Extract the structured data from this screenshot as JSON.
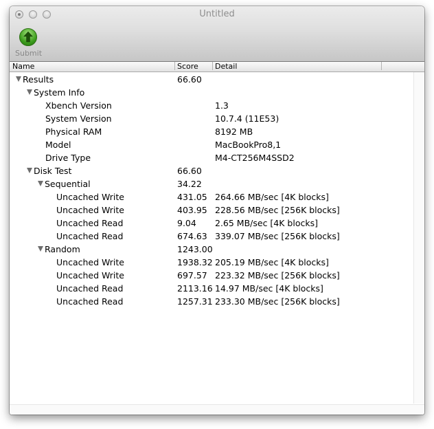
{
  "window": {
    "title": "Untitled"
  },
  "toolbar": {
    "submit_label": "Submit"
  },
  "columns": {
    "name": "Name",
    "score": "Score",
    "detail": "Detail"
  },
  "rows": [
    {
      "name": "Results",
      "score": "66.60",
      "detail": "",
      "level": 0,
      "expandable": true
    },
    {
      "name": "System Info",
      "score": "",
      "detail": "",
      "level": 1,
      "expandable": true
    },
    {
      "name": "Xbench Version",
      "score": "",
      "detail": "1.3",
      "level": 2,
      "expandable": false
    },
    {
      "name": "System Version",
      "score": "",
      "detail": "10.7.4 (11E53)",
      "level": 2,
      "expandable": false
    },
    {
      "name": "Physical RAM",
      "score": "",
      "detail": "8192 MB",
      "level": 2,
      "expandable": false
    },
    {
      "name": "Model",
      "score": "",
      "detail": "MacBookPro8,1",
      "level": 2,
      "expandable": false
    },
    {
      "name": "Drive Type",
      "score": "",
      "detail": "M4-CT256M4SSD2",
      "level": 2,
      "expandable": false
    },
    {
      "name": "Disk Test",
      "score": "66.60",
      "detail": "",
      "level": 1,
      "expandable": true
    },
    {
      "name": "Sequential",
      "score": "34.22",
      "detail": "",
      "level": 2,
      "expandable": true
    },
    {
      "name": "Uncached Write",
      "score": "431.05",
      "detail": "264.66 MB/sec [4K blocks]",
      "level": 3,
      "expandable": false
    },
    {
      "name": "Uncached Write",
      "score": "403.95",
      "detail": "228.56 MB/sec [256K blocks]",
      "level": 3,
      "expandable": false
    },
    {
      "name": "Uncached Read",
      "score": "9.04",
      "detail": "2.65 MB/sec [4K blocks]",
      "level": 3,
      "expandable": false
    },
    {
      "name": "Uncached Read",
      "score": "674.63",
      "detail": "339.07 MB/sec [256K blocks]",
      "level": 3,
      "expandable": false
    },
    {
      "name": "Random",
      "score": "1243.00",
      "detail": "",
      "level": 2,
      "expandable": true
    },
    {
      "name": "Uncached Write",
      "score": "1938.32",
      "detail": "205.19 MB/sec [4K blocks]",
      "level": 3,
      "expandable": false
    },
    {
      "name": "Uncached Write",
      "score": "697.57",
      "detail": "223.32 MB/sec [256K blocks]",
      "level": 3,
      "expandable": false
    },
    {
      "name": "Uncached Read",
      "score": "2113.16",
      "detail": "14.97 MB/sec [4K blocks]",
      "level": 3,
      "expandable": false
    },
    {
      "name": "Uncached Read",
      "score": "1257.31",
      "detail": "233.30 MB/sec [256K blocks]",
      "level": 3,
      "expandable": false
    }
  ]
}
